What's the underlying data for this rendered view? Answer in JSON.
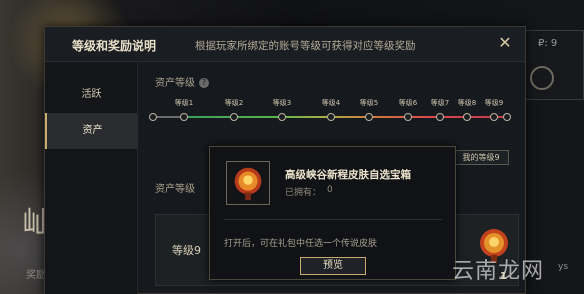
{
  "background": {
    "right_text": "₽: 9",
    "left_big_text": "屾",
    "left_small_text": "奖励"
  },
  "dialog": {
    "title": "等级和奖励说明",
    "subtitle": "根据玩家所绑定的账号等级可获得对应等级奖励",
    "close_label": "✕"
  },
  "sidebar": {
    "items": [
      {
        "label": "活跃"
      },
      {
        "label": "资产"
      }
    ]
  },
  "content": {
    "section1_label": "资产等级",
    "info_icon": "?",
    "levels": [
      "等级1",
      "等级2",
      "等级3",
      "等级4",
      "等级5",
      "等级6",
      "等级7",
      "等级8",
      "等级9"
    ],
    "my_level_button": "我的等级9",
    "section2_label": "资产等级",
    "level_row_label": "等级9",
    "right_item_count": "1"
  },
  "popup": {
    "title": "高级峡谷新程皮肤自选宝箱",
    "owned_label": "已拥有：",
    "owned_value": "0",
    "description": "打开后，可在礼包中任选一个传说皮肤",
    "preview_button": "预览",
    "item_count": "1"
  },
  "watermark": {
    "text": "云南龙网",
    "sub": "ys"
  },
  "colors": {
    "accent_gold": "#c8aa6e",
    "track_start": "#3ba05a",
    "track_end": "#c23a4a"
  }
}
